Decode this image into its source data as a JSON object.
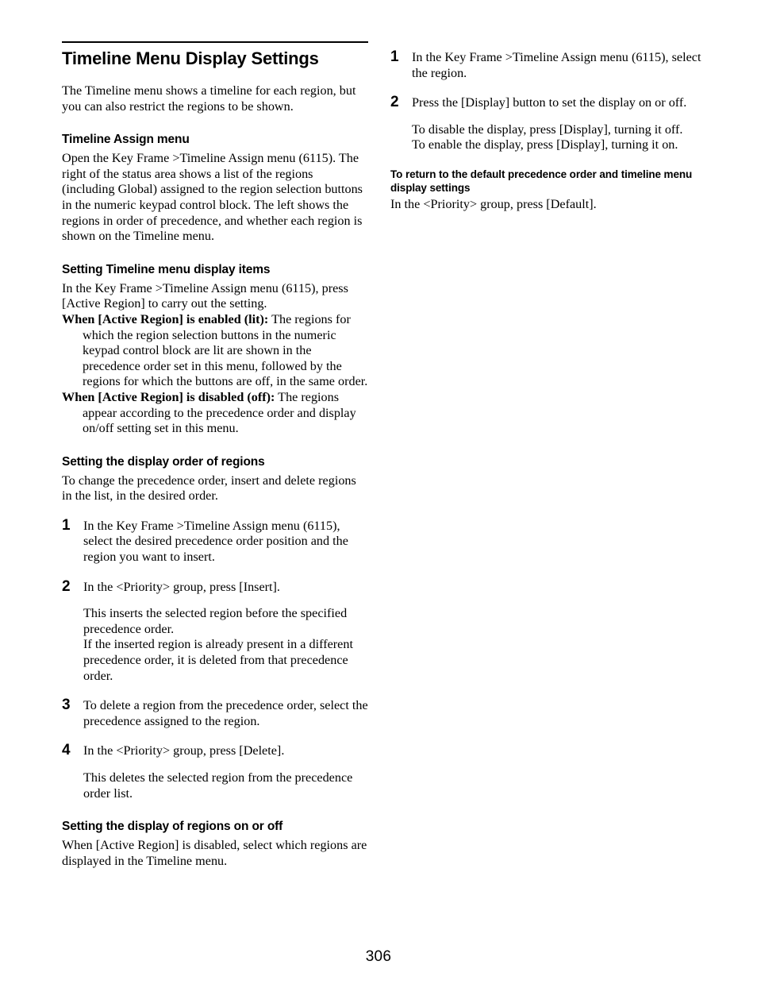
{
  "page": {
    "number": "306"
  },
  "left_column": {
    "title": "Timeline Menu Display Settings",
    "intro": "The Timeline menu shows a timeline for each region, but you can also restrict the regions to be shown.",
    "section_assign": {
      "heading": "Timeline Assign menu",
      "body": "Open the Key Frame >Timeline Assign menu (6115). The right of the status area shows a list of the regions (including Global) assigned to the region selection buttons in the numeric keypad control block. The left shows the regions in order of precedence, and whether each region is shown on the Timeline menu."
    },
    "section_display_items": {
      "heading": "Setting Timeline menu display items",
      "body": "In the Key Frame >Timeline Assign menu (6115), press [Active Region] to carry out the setting.",
      "definitions": [
        {
          "term": "When [Active Region] is enabled (lit):",
          "description": " The regions for which the region selection buttons in the numeric keypad control block are lit are shown in the precedence order set in this menu, followed by the regions for which the buttons are off, in the same order."
        },
        {
          "term": "When [Active Region] is disabled (off):",
          "description": " The regions appear according to the precedence order and display on/off setting set in this menu."
        }
      ]
    },
    "section_display_order": {
      "heading": "Setting the display order of regions",
      "body": "To change the precedence order, insert and delete regions in the list, in the desired order.",
      "steps": [
        {
          "number": "1",
          "paragraphs": [
            "In the Key Frame >Timeline Assign menu (6115), select the desired precedence order position and the region you want to insert."
          ]
        },
        {
          "number": "2",
          "paragraphs": [
            "In the <Priority> group, press [Insert].",
            "This inserts the selected region before the specified precedence order.",
            "If the inserted region is already present in a different precedence order, it is deleted from that precedence order."
          ]
        },
        {
          "number": "3",
          "paragraphs": [
            "To delete a region from the precedence order, select the precedence assigned to the region."
          ]
        },
        {
          "number": "4",
          "paragraphs": [
            "In the <Priority> group, press [Delete].",
            "This deletes the selected region from the precedence order list."
          ]
        }
      ]
    },
    "section_display_onoff": {
      "heading": "Setting the display of regions on or off",
      "body": "When [Active Region] is disabled, select which regions are displayed in the Timeline menu."
    }
  },
  "right_column": {
    "steps": [
      {
        "number": "1",
        "paragraphs": [
          "In the Key Frame >Timeline Assign menu (6115), select the region."
        ]
      },
      {
        "number": "2",
        "paragraphs": [
          "Press the [Display] button to set the display on or off.",
          "To disable the display, press [Display], turning it off.",
          "To enable the display, press [Display], turning it on."
        ]
      }
    ],
    "section_default": {
      "heading": "To return to the default precedence order and timeline menu display settings",
      "body": "In the <Priority> group, press [Default]."
    }
  }
}
